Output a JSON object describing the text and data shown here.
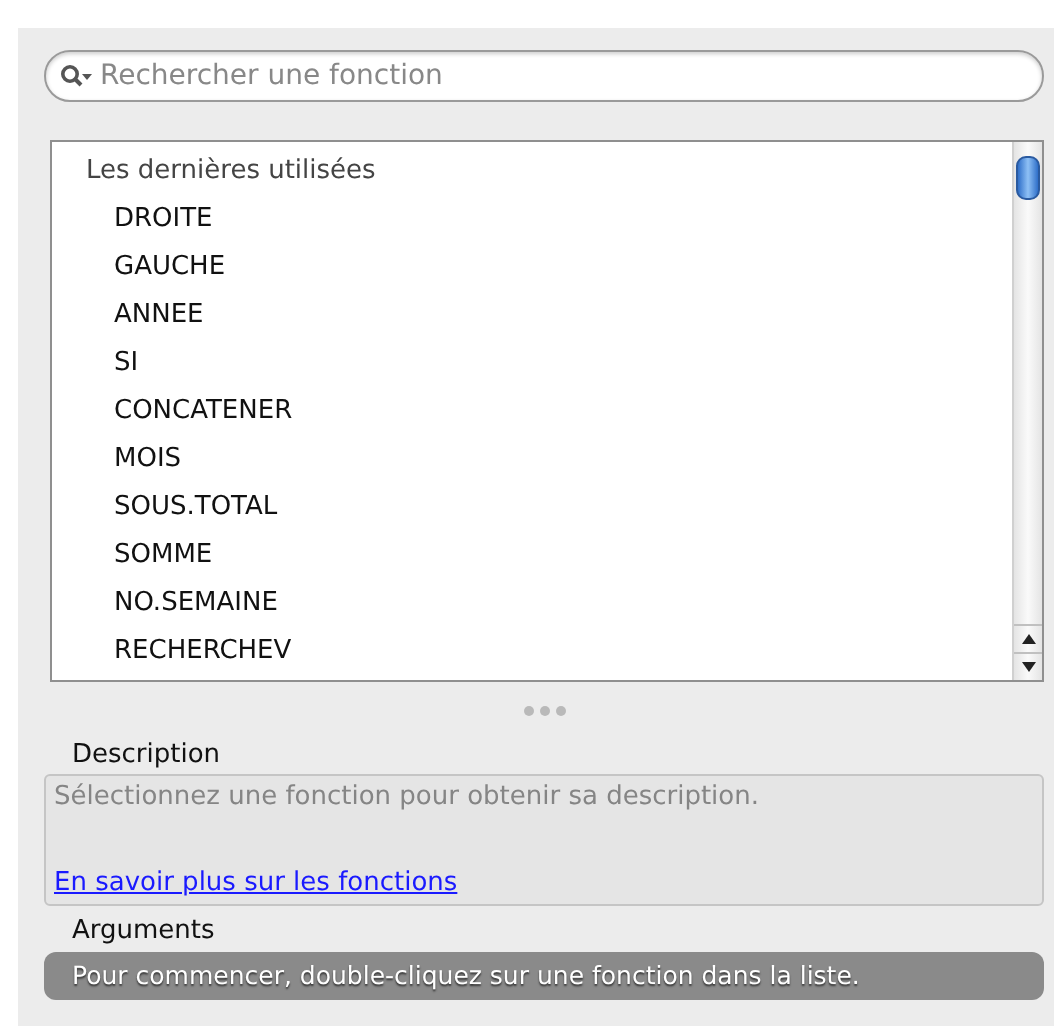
{
  "search": {
    "placeholder": "Rechercher une fonction"
  },
  "function_list": [
    {
      "label": "Les dernières utilisées",
      "children": [
        {
          "label": "DROITE"
        },
        {
          "label": "GAUCHE"
        },
        {
          "label": "ANNEE"
        },
        {
          "label": "SI"
        },
        {
          "label": "CONCATENER"
        },
        {
          "label": "MOIS"
        },
        {
          "label": "SOUS.TOTAL"
        },
        {
          "label": "SOMME"
        },
        {
          "label": "NO.SEMAINE"
        },
        {
          "label": "RECHERCHEV"
        }
      ]
    }
  ],
  "description": {
    "label": "Description",
    "text": "Sélectionnez une fonction pour obtenir sa description.",
    "link": "En savoir plus sur les fonctions"
  },
  "arguments": {
    "label": "Arguments",
    "hint": "Pour commencer, double-cliquez sur une fonction dans la liste."
  }
}
